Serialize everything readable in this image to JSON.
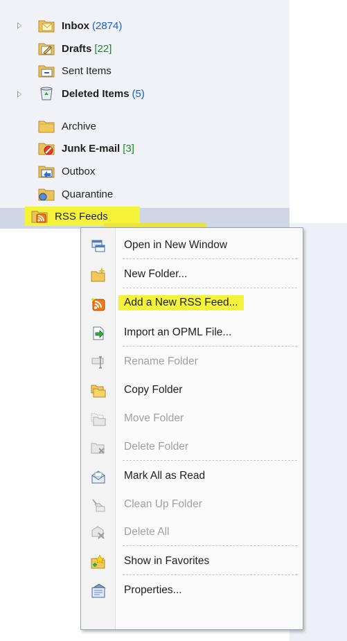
{
  "folders": [
    {
      "name": "Inbox",
      "count": "(2874)",
      "count_style": "blue",
      "bold": true,
      "expander": true,
      "icon": "inbox-icon"
    },
    {
      "name": "Drafts",
      "count": "[22]",
      "count_style": "green",
      "bold": true,
      "expander": false,
      "icon": "drafts-icon"
    },
    {
      "name": "Sent Items",
      "count": "",
      "bold": false,
      "expander": false,
      "icon": "sent-items-icon"
    },
    {
      "name": "Deleted Items",
      "count": "(5)",
      "count_style": "blue",
      "bold": true,
      "expander": true,
      "icon": "deleted-items-icon"
    },
    {
      "name": "Archive",
      "count": "",
      "bold": false,
      "expander": false,
      "icon": "archive-folder-icon"
    },
    {
      "name": "Junk E-mail",
      "count": "[3]",
      "count_style": "green",
      "bold": true,
      "expander": false,
      "icon": "junk-email-icon"
    },
    {
      "name": "Outbox",
      "count": "",
      "bold": false,
      "expander": false,
      "icon": "outbox-icon"
    },
    {
      "name": "Quarantine",
      "count": "",
      "bold": false,
      "expander": false,
      "icon": "quarantine-folder-icon"
    },
    {
      "name": "RSS Feeds",
      "count": "",
      "bold": false,
      "expander": false,
      "icon": "rss-feeds-icon",
      "highlighted": true
    }
  ],
  "context_menu": {
    "items": [
      {
        "label": "Open in New Window",
        "icon": "open-new-window-icon",
        "enabled": true
      },
      {
        "label": "New Folder...",
        "icon": "new-folder-icon",
        "enabled": true
      },
      {
        "label": "Add a New RSS Feed...",
        "icon": "add-rss-feed-icon",
        "enabled": true,
        "highlighted": true
      },
      {
        "label": "Import an OPML File...",
        "icon": "import-opml-icon",
        "enabled": true
      },
      {
        "label": "Rename Folder",
        "icon": "rename-folder-icon",
        "enabled": false
      },
      {
        "label": "Copy Folder",
        "icon": "copy-folder-icon",
        "enabled": true
      },
      {
        "label": "Move Folder",
        "icon": "move-folder-icon",
        "enabled": false
      },
      {
        "label": "Delete Folder",
        "icon": "delete-folder-icon",
        "enabled": false
      },
      {
        "label": "Mark All as Read",
        "icon": "mark-all-read-icon",
        "enabled": true
      },
      {
        "label": "Clean Up Folder",
        "icon": "clean-up-folder-icon",
        "enabled": false
      },
      {
        "label": "Delete All",
        "icon": "delete-all-icon",
        "enabled": false
      },
      {
        "label": "Show in Favorites",
        "icon": "show-in-favorites-icon",
        "enabled": true
      },
      {
        "label": "Properties...",
        "icon": "properties-icon",
        "enabled": true
      }
    ]
  },
  "colors": {
    "highlight": "#f5f23a",
    "count_blue": "#1f5fc7",
    "count_green": "#1a8a2a",
    "disabled_text": "#a0a0a0"
  }
}
